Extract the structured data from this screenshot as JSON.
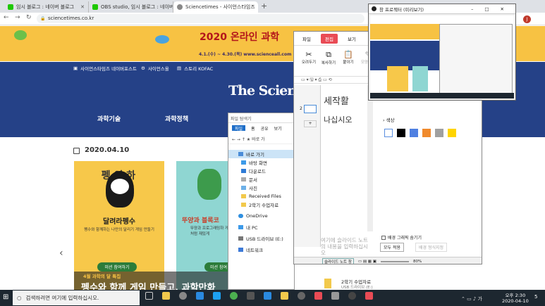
{
  "browser": {
    "tabs": [
      {
        "label": "임시 블로그 : 네이버 블로그",
        "color": "#1ec800",
        "active": false
      },
      {
        "label": "OBS studio, 임시 블로그 : 네이버",
        "color": "#1ec800",
        "active": false
      },
      {
        "label": "Sciencetimes - 사이언스타임즈",
        "color": "#666666",
        "active": true
      }
    ],
    "url": "sciencetimes.co.kr"
  },
  "page": {
    "banner_title": "2020 온라인 과학",
    "banner_sub": "4.1.(수) ~ 4.30.(목) www.scienceall.com",
    "toplinks": [
      "사이언스타임즈 네이버포스트",
      "사이언스올",
      "스토리 KOFAC"
    ],
    "logo": "The ScienceTimes",
    "nav": [
      "과학기술",
      "과학정책"
    ],
    "date": "2020.04.10",
    "card1": {
      "title": "펭 이 하",
      "subtitle": "달려라펭수",
      "desc": "펭수와 함께하는 나만의 달리기 게임 만들기",
      "btn": "미션 참여하기"
    },
    "card2": {
      "title": "뚜양과 블록코",
      "desc": "뚜양과 프로그래밍하 게임처럼 재밌게",
      "btn": "미션 참여"
    },
    "badge": "4월 과학의 달 특집",
    "headline": "펭수와 함께 게임 만들고, 과학만화"
  },
  "explorer": {
    "title": "파일 탐색기",
    "tabs": [
      "파일",
      "홈",
      "공유",
      "보기"
    ],
    "path": "바로 가",
    "items": [
      "바로 가기",
      "바탕 화면",
      "다운로드",
      "문서",
      "사진",
      "Received Files",
      "2학기 수업자료",
      "OneDrive",
      "내 PC",
      "USB 드라이브 (E:)",
      "네트워크"
    ],
    "file_name": "2학기 수업자료",
    "file_sub": "USB 드라이브 (E:)"
  },
  "editor": {
    "tabs": [
      "파일",
      "편집",
      "보기"
    ],
    "tools": [
      "오려두기",
      "복사하기",
      "붙이기",
      "모양복사"
    ],
    "page_num": "2",
    "title_text": "세작활",
    "body_text": "나십시오",
    "placeholder": "여기에 슬라이드 노트의 내용을 입력하십시오",
    "pen_label": "펜",
    "color_label": "색상",
    "colors": [
      "#ffffff",
      "#000000",
      "#4f80e1",
      "#f08a2c",
      "#a0a0a0",
      "#ffd400"
    ],
    "bg_hide": "배경 그래픽 숨기기",
    "apply_all": "모두 적용",
    "bg_format": "배경 형식지정",
    "status_tab": "슬라이드 노트 창",
    "zoom": "80%"
  },
  "projector": {
    "title": "창 프로젝터 (미리보기)"
  },
  "taskbar": {
    "search": "검색하려면 여기에 입력하십시오.",
    "time": "오후 2:30",
    "date": "2020-04-10",
    "notif": "5"
  }
}
